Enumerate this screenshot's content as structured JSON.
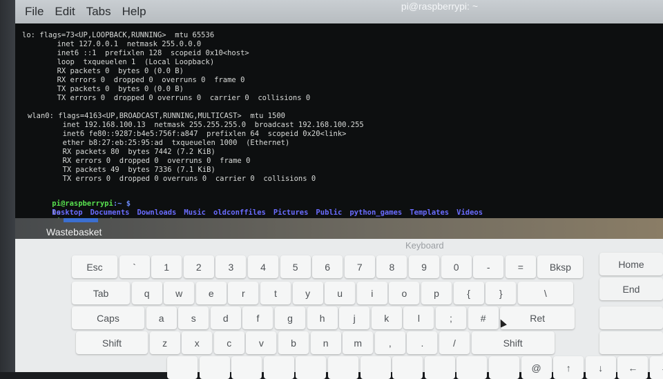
{
  "menubar": {
    "items": [
      "File",
      "Edit",
      "Tabs",
      "Help"
    ],
    "title": "pi@raspberrypi: ~"
  },
  "terminal": {
    "lines": [
      "lo: flags=73<UP,LOOPBACK,RUNNING>  mtu 65536",
      "        inet 127.0.0.1  netmask 255.0.0.0",
      "        inet6 ::1  prefixlen 128  scopeid 0x10<host>",
      "        loop  txqueuelen 1  (Local Loopback)",
      "        RX packets 0  bytes 0 (0.0 B)",
      "        RX errors 0  dropped 0  overruns 0  frame 0",
      "        TX packets 0  bytes 0 (0.0 B)",
      "        TX errors 0  dropped 0 overruns 0  carrier 0  collisions 0",
      "",
      "wlan0: flags=4163<UP,BROADCAST,RUNNING,MULTICAST>  mtu 1500",
      "        inet 192.168.100.13  netmask 255.255.255.0  broadcast 192.168.100.255",
      "        inet6 fe80::9287:b4e5:756f:a847  prefixlen 64  scopeid 0x20<link>",
      "        ether b8:27:eb:25:95:ad  txqueuelen 1000  (Ethernet)",
      "        RX packets 80  bytes 7442 (7.2 KiB)",
      "        RX errors 0  dropped 0  overruns 0  frame 0",
      "        TX packets 49  bytes 7336 (7.1 KiB)",
      "        TX errors 0  dropped 0 overruns 0  carrier 0  collisions 0"
    ],
    "prompt_user": "pi@raspberrypi",
    "prompt_tail": ":~ $",
    "command": "ls",
    "ls_output": [
      "Desktop",
      "Documents",
      "Downloads",
      "Music",
      "oldconffiles",
      "Pictures",
      "Public",
      "python_games",
      "Templates",
      "Videos"
    ]
  },
  "desktop": {
    "wastebasket_label": "Wastebasket"
  },
  "keyboard": {
    "title": "Keyboard",
    "rows": [
      [
        "Esc",
        "`",
        "1",
        "2",
        "3",
        "4",
        "5",
        "6",
        "7",
        "8",
        "9",
        "0",
        "-",
        "=",
        "Bksp"
      ],
      [
        "Tab",
        "q",
        "w",
        "e",
        "r",
        "t",
        "y",
        "u",
        "i",
        "o",
        "p",
        "{",
        "}",
        "\\"
      ],
      [
        "Caps",
        "a",
        "s",
        "d",
        "f",
        "g",
        "h",
        "j",
        "k",
        "l",
        ";",
        "#",
        "Ret"
      ],
      [
        "Shift",
        "z",
        "x",
        "c",
        "v",
        "b",
        "n",
        "m",
        ",",
        ".",
        "/",
        "Shift"
      ],
      [
        "",
        "",
        "",
        "",
        "",
        "",
        "",
        "",
        "",
        "",
        "",
        "@",
        "↑",
        "↓",
        "←",
        "→"
      ]
    ],
    "side_keys": [
      "Home",
      "End",
      "",
      ""
    ]
  },
  "colors": {
    "terminal_bg": "#0d0f10",
    "prompt_green": "#58e04f",
    "directory_blue": "#6a6cff"
  }
}
